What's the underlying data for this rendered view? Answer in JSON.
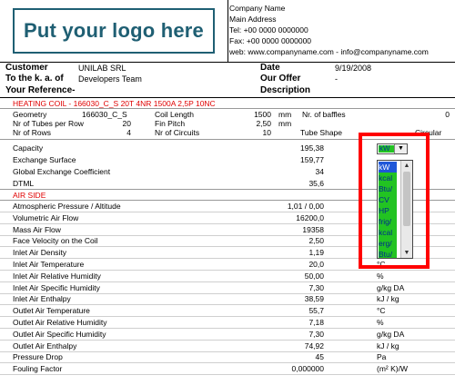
{
  "header": {
    "logo_text": "Put your logo here",
    "company_lines": [
      "Company Name",
      "Main Address",
      "Tel: +00 0000 0000000",
      "Fax: +00 0000 0000000",
      "web: www.companyname.com  -  info@companyname.com"
    ]
  },
  "info": {
    "customer_label": "Customer",
    "customer_value": "UNILAB SRL",
    "attention_label": "To the k. a. of",
    "attention_value": "Developers Team",
    "reference_label": "Your Reference-",
    "date_label": "Date",
    "date_value": "9/19/2008",
    "offer_label": "Our Offer",
    "offer_value": "-",
    "description_label": "Description"
  },
  "section_heating": {
    "title": "HEATING COIL - 166030_C_S 20T 4NR 1500A 2,5P 10NC",
    "geometry_label": "Geometry",
    "geometry_value": "166030_C_S",
    "tubes_per_row_label": "Nr of Tubes per Row",
    "tubes_per_row_value": "20",
    "rows_label": "Nr of Rows",
    "rows_value": "4",
    "coil_length_label": "Coil Length",
    "coil_length_value": "1500",
    "coil_length_unit": "mm",
    "fin_pitch_label": "Fin Pitch",
    "fin_pitch_value": "2,50",
    "fin_pitch_unit": "mm",
    "circuits_label": "Nr of Circuits",
    "circuits_value": "10",
    "baffles_label": "Nr. of baffles",
    "baffles_value": "0",
    "tube_shape_label": "Tube Shape",
    "tube_shape_value": "Circular"
  },
  "performance": [
    {
      "label": "Capacity",
      "value": "195,38"
    },
    {
      "label": "Exchange Surface",
      "value": "159,77"
    },
    {
      "label": "Global Exchange Coefficient",
      "value": "34"
    },
    {
      "label": "DTML",
      "value": "35,6"
    }
  ],
  "air_side": {
    "title": "AIR SIDE",
    "rows": [
      {
        "label": "Atmospheric Pressure / Altitude",
        "value": "1,01 / 0,00",
        "unit": ""
      },
      {
        "label": "Volumetric Air Flow",
        "value": "16200,0",
        "unit": ""
      },
      {
        "label": "Mass Air Flow",
        "value": "19358",
        "unit": ""
      },
      {
        "label": "Face Velocity on the Coil",
        "value": "2,50",
        "unit": ""
      },
      {
        "label": "Inlet Air Density",
        "value": "1,19",
        "unit": ""
      },
      {
        "label": "Inlet Air Temperature",
        "value": "20,0",
        "unit": "°C"
      },
      {
        "label": "Inlet Air Relative Humidity",
        "value": "50,00",
        "unit": "%"
      },
      {
        "label": "Inlet Air Specific Humidity",
        "value": "7,30",
        "unit": "g/kg DA"
      },
      {
        "label": "Inlet Air Enthalpy",
        "value": "38,59",
        "unit": "kJ / kg"
      },
      {
        "label": "Outlet Air Temperature",
        "value": "55,7",
        "unit": "°C"
      },
      {
        "label": "Outlet Air Relative Humidity",
        "value": "7,18",
        "unit": "%"
      },
      {
        "label": "Outlet Air Specific Humidity",
        "value": "7,30",
        "unit": "g/kg DA"
      },
      {
        "label": "Outlet Air Enthalpy",
        "value": "74,92",
        "unit": "kJ / kg"
      },
      {
        "label": "Pressure Drop",
        "value": "45",
        "unit": "Pa"
      },
      {
        "label": "Fouling Factor",
        "value": "0,000000",
        "unit": "(m² K)/W"
      }
    ]
  },
  "unit_dropdown": {
    "selected": "kW",
    "options": [
      "kW",
      "kcal",
      "Btu/",
      "CV",
      "HP",
      "frig/",
      "kcal",
      "erg/",
      "Btu/"
    ],
    "highlight_color": "#ff0000",
    "option_color": "#22c322",
    "selected_color": "#1f57d8"
  }
}
